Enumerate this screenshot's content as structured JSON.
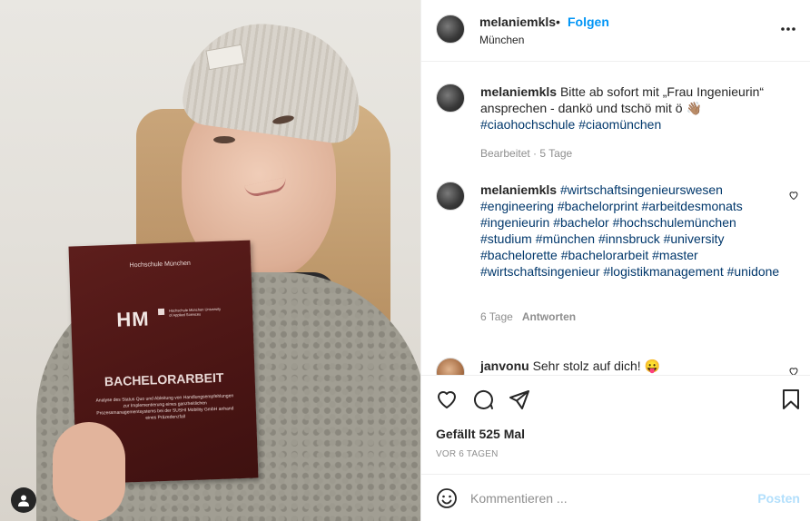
{
  "post": {
    "username": "melaniemkls",
    "separator": "•",
    "follow_label": "Folgen",
    "location": "München",
    "more_icon": "more-horizontal-icon"
  },
  "photo": {
    "book_school": "Hochschule München",
    "book_logo": "HM",
    "book_logo_sub": "Hochschule München University of Applied Sciences",
    "book_title": "BACHELORARBEIT",
    "book_description": "Analyse des Status Quo und Ableitung von Handlungsempfehlungen zur Implementierung eines ganzheitlichen Prozessmanagementsystems bei der SUSHI Mobility GmbH anhand eines Präzedenzfall",
    "tag_icon": "user-tag-icon"
  },
  "caption": {
    "username": "melaniemkls",
    "text": "Bitte ab sofort mit „Frau Ingenieurin“ ansprechen - dankö und tschö mit ö 👋🏽",
    "tags": [
      "#ciaohochschule",
      "#ciaomünchen"
    ],
    "meta": "Bearbeitet · 5 Tage"
  },
  "comments": [
    {
      "username": "melaniemkls",
      "tags": [
        "#wirtschaftsingenieurswesen",
        "#engineering",
        "#bachelorprint",
        "#arbeitdesmonats",
        "#ingenieurin",
        "#bachelor",
        "#hochschulemünchen",
        "#studium",
        "#münchen",
        "#innsbruck",
        "#university",
        "#bachelorette",
        "#bachelorarbeit",
        "#master",
        "#wirtschaftsingenieur",
        "#logistikmanagement",
        "#unidone"
      ],
      "time": "6 Tage",
      "reply": "Antworten"
    },
    {
      "username": "janvonu",
      "text": "Sehr stolz auf dich! 😛"
    }
  ],
  "actions": {
    "likes": "Gefällt 525 Mal",
    "date": "VOR 6 TAGEN",
    "comment_placeholder": "Kommentieren ...",
    "post_label": "Posten"
  }
}
